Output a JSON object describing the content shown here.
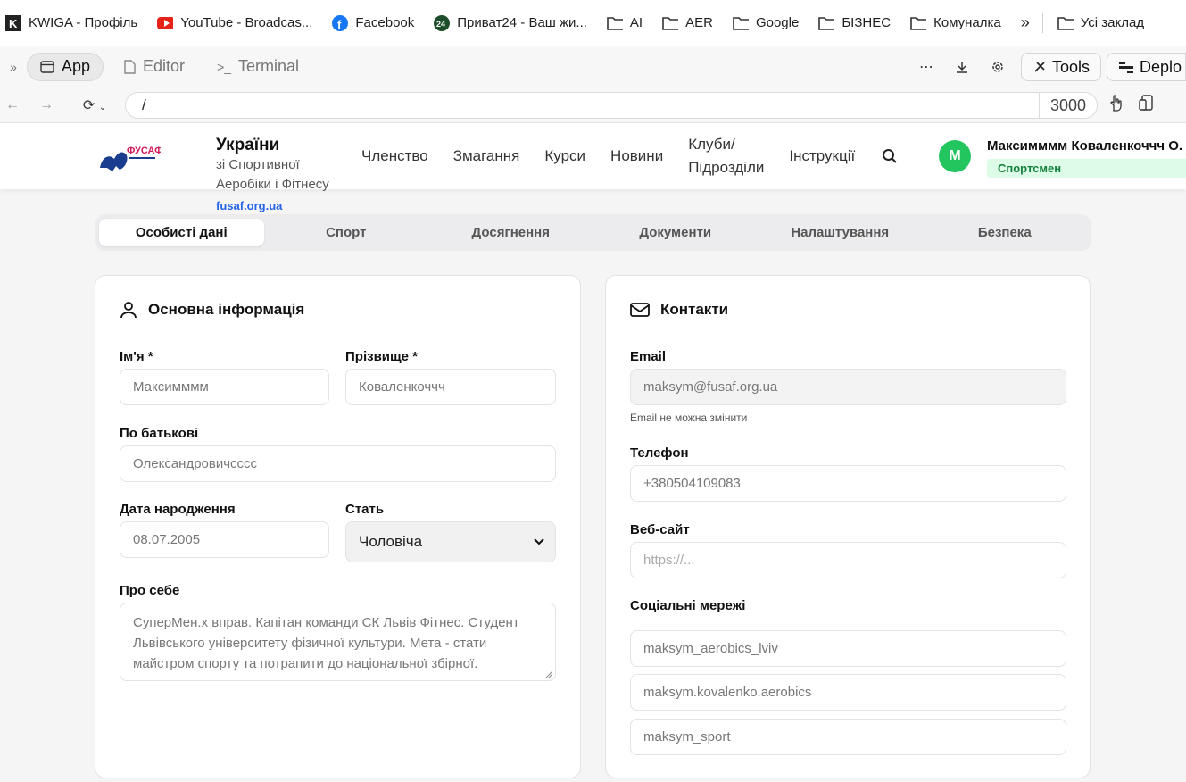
{
  "bookmarks": [
    {
      "label": "KWIGA - Профіль",
      "icon": "kwiga-icon"
    },
    {
      "label": "YouTube - Broadcas...",
      "icon": "youtube-icon"
    },
    {
      "label": "Facebook",
      "icon": "facebook-icon"
    },
    {
      "label": "Приват24 - Ваш жи...",
      "icon": "privat24-icon"
    },
    {
      "label": "AI",
      "icon": "folder-icon"
    },
    {
      "label": "AER",
      "icon": "folder-icon"
    },
    {
      "label": "Google",
      "icon": "folder-icon"
    },
    {
      "label": "БІЗНЕС",
      "icon": "folder-icon"
    },
    {
      "label": "Комуналка",
      "icon": "folder-icon"
    }
  ],
  "bookmarks_overflow": "»",
  "bookmarks_all": "Усі заклад",
  "toolbar": {
    "app_label": "App",
    "editor_label": "Editor",
    "terminal_label": "Terminal",
    "tools_label": "Tools",
    "deploy_label": "Deplo"
  },
  "urlbar": {
    "path": "/",
    "port": "3000"
  },
  "header": {
    "org_title": "України",
    "org_sub1": "зі Спортивної",
    "org_sub2": "Аеробіки і Фітнесу",
    "org_link": "fusaf.org.ua",
    "logo_text": "ФУСАФ",
    "nav": [
      "Членство",
      "Змагання",
      "Курси",
      "Новини",
      "Клуби/",
      "Підрозділи",
      "Інструкції"
    ],
    "avatar_letter": "M",
    "user_name": "Максимммм Коваленкоччч О.",
    "user_role": "Спортсмен"
  },
  "tabs": [
    "Особисті дані",
    "Спорт",
    "Досягнення",
    "Документи",
    "Налаштування",
    "Безпека"
  ],
  "basic": {
    "title": "Основна інформація",
    "first_name_label": "Ім'я *",
    "first_name": "Максимммм",
    "last_name_label": "Прізвище *",
    "last_name": "Коваленкоччч",
    "patronymic_label": "По батькові",
    "patronymic": "Олександровичсссс",
    "birth_label": "Дата народження",
    "birth": "08.07.2005",
    "gender_label": "Стать",
    "gender": "Чоловіча",
    "about_label": "Про себе",
    "about_line1": "СуперМен.х вправ. Капітан команди СК Львів Фітнес. Студент",
    "about_line2": "Львівського університету фізичної культури. Мета - стати",
    "about_line3": "майстром спорту та потрапити до національної збірної."
  },
  "contacts": {
    "title": "Контакти",
    "email_label": "Email",
    "email": "maksym@fusaf.org.ua",
    "email_hint": "Email не можна змінити",
    "phone_label": "Телефон",
    "phone": "+380504109083",
    "website_label": "Веб-сайт",
    "website_placeholder": "https://...",
    "social_label": "Соціальні мережі",
    "social": [
      "maksym_aerobics_lviv",
      "maksym.kovalenko.aerobics",
      "maksym_sport"
    ]
  },
  "colors": {
    "accent": "#22c55e",
    "link": "#2563eb",
    "role_bg": "#dcfce7",
    "role_text": "#15803d"
  }
}
